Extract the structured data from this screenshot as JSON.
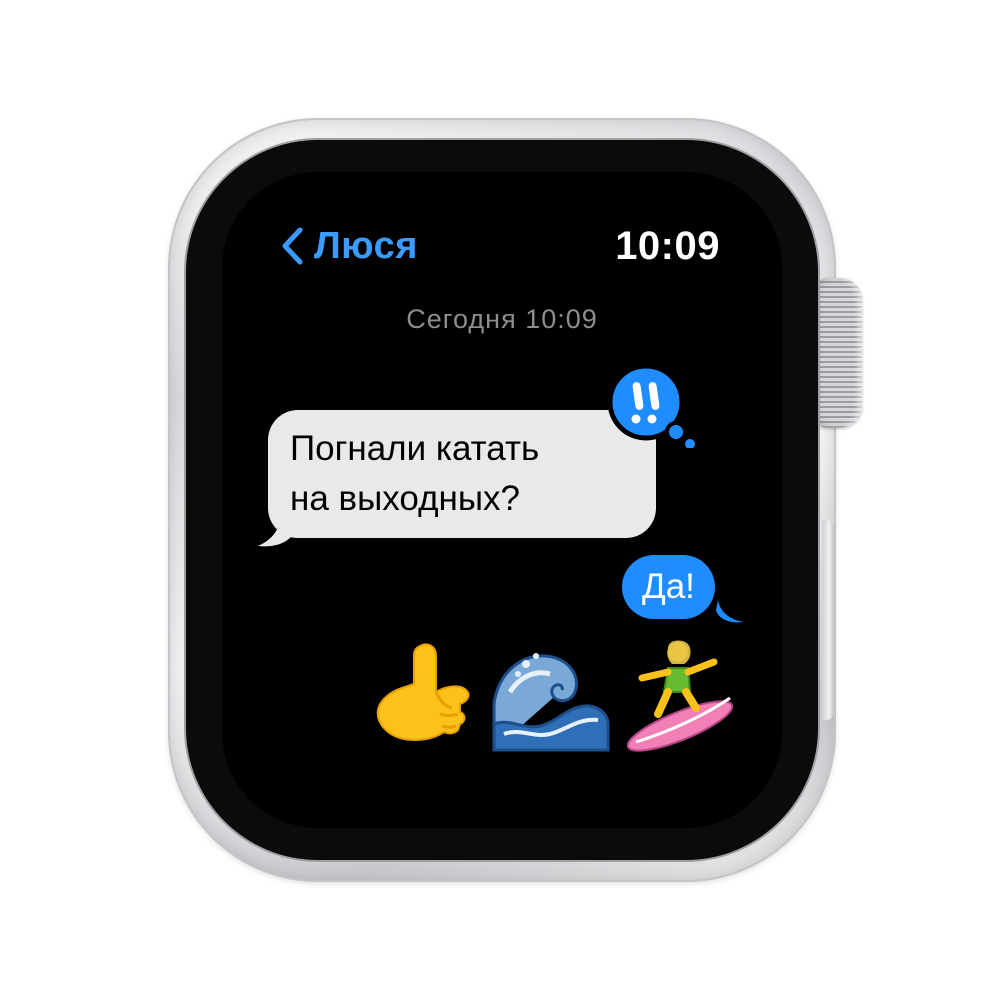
{
  "watch": {
    "contact_name": "Люся",
    "clock": "10:09",
    "date_stamp": "Сегодня 10:09"
  },
  "conversation": {
    "incoming_message": {
      "line1": "Погнали катать",
      "line2": "на выходных?",
      "tapback_icon": "exclamation-tapback-icon"
    },
    "outgoing_message": "Да!",
    "emoji_icons": [
      "call-me-hand-icon",
      "water-wave-icon",
      "woman-surfing-icon"
    ]
  },
  "colors": {
    "accent_blue": "#3b9bff",
    "outgoing_bubble": "#1f8cff",
    "incoming_bubble": "#e9e9eb",
    "screen_background": "#000000",
    "case_silver": "#e6e7e9"
  }
}
